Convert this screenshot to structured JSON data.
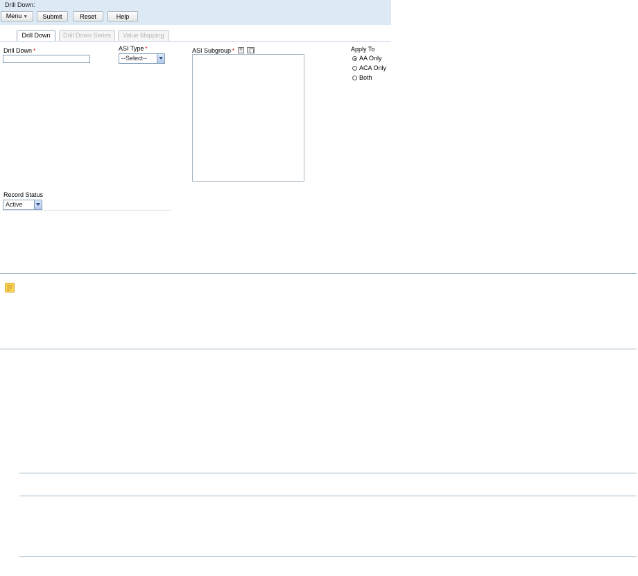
{
  "header": {
    "title": "Drill Down:",
    "buttons": {
      "menu": "Menu",
      "submit": "Submit",
      "reset": "Reset",
      "help": "Help"
    }
  },
  "tabs": [
    {
      "label": "Drill Down",
      "active": true
    },
    {
      "label": "Drill Down Series",
      "active": false
    },
    {
      "label": "Value Mapping",
      "active": false
    }
  ],
  "form": {
    "drill_down": {
      "label": "Drill Down",
      "required_mark": "*",
      "value": ""
    },
    "asi_type": {
      "label": "ASI Type",
      "required_mark": "*",
      "selected": "--Select--"
    },
    "asi_subgroup": {
      "label": "ASI Subgroup",
      "required_mark": "*",
      "items": []
    },
    "apply_to": {
      "label": "Apply To",
      "options": [
        {
          "label": "AA Only",
          "checked": true
        },
        {
          "label": "ACA Only",
          "checked": false
        },
        {
          "label": "Both",
          "checked": false
        }
      ]
    },
    "record_status": {
      "label": "Record Status",
      "selected": "Active"
    }
  },
  "icons": {
    "menu_caret": "chevron-down-icon",
    "note": "note-icon",
    "subgroup_add": "add-icon",
    "subgroup_delete": "delete-icon"
  },
  "colors": {
    "header_bg": "#dde9f5",
    "required": "#dd0000",
    "note_yellow": "#fbd65c"
  }
}
